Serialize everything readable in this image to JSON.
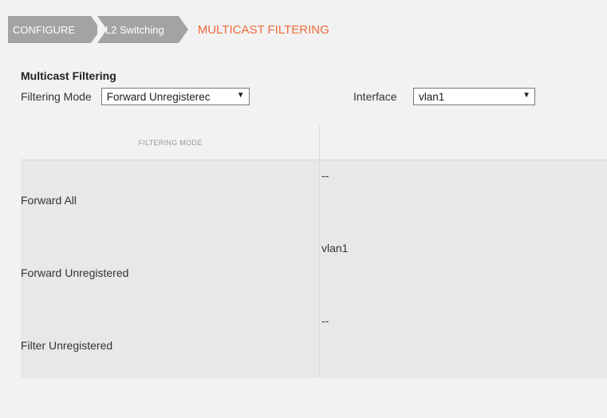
{
  "breadcrumb": {
    "items": [
      "CONFIGURE",
      "L2 Switching"
    ],
    "current": "MULTICAST FILTERING"
  },
  "section": {
    "title": "Multicast Filtering"
  },
  "filters": {
    "mode_label": "Filtering Mode",
    "mode_value": "Forward Unregisterec",
    "interface_label": "Interface",
    "interface_value": "vlan1"
  },
  "table": {
    "headers": [
      "FILTERING MODE",
      ""
    ],
    "rows": [
      {
        "mode": "Forward All",
        "interface": "--"
      },
      {
        "mode": "Forward Unregistered",
        "interface": "vlan1"
      },
      {
        "mode": "Filter Unregistered",
        "interface": "--"
      }
    ]
  },
  "colors": {
    "accent": "#f06a3c",
    "crumb_bg": "#a3a3a3",
    "page_bg": "#f2f2f2",
    "table_body_bg": "#e8e8e8"
  }
}
